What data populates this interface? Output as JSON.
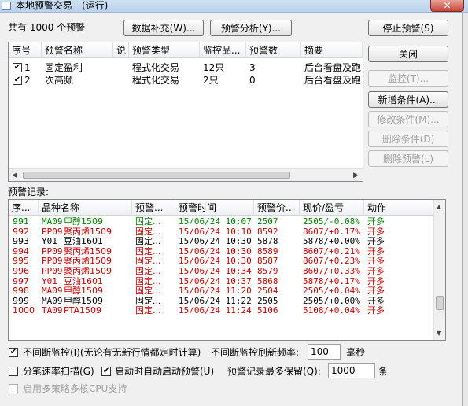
{
  "window": {
    "title": "本地预警交易 - (运行)",
    "close_glyph": "✕"
  },
  "summary": {
    "prefix": "共有",
    "count": "1000",
    "suffix": "个预警"
  },
  "toolbar": {
    "data_supplement": "数据补充(W)...",
    "alert_analysis": "预警分析(Y)..."
  },
  "side_buttons": {
    "stop_alert": "停止预警(S)",
    "close": "关闭",
    "monitor": "监控(T)...",
    "add_condition": "新增条件(A)...",
    "modify_condition": "修改条件(M)...",
    "delete_condition": "删除条件(D)",
    "delete_alert": "删除预警(L)"
  },
  "conditions": {
    "headers": [
      "序号",
      "预警名称",
      "说",
      "预警类型",
      "监控品...",
      "预警数",
      "摘要"
    ],
    "rows": [
      {
        "checked": true,
        "index": "1",
        "name": "固定盈利",
        "type": "程式化交易",
        "monitor": "12只",
        "count": "3",
        "summary": "后台看盘及跑"
      },
      {
        "checked": true,
        "index": "2",
        "name": "次高频",
        "type": "程式化交易",
        "monitor": "2只",
        "count": "0",
        "summary": "后台看盘及跑"
      }
    ]
  },
  "records": {
    "label": "预警记录:",
    "headers": [
      "序...",
      "品种名称",
      "预警...",
      "预警时间",
      "预警价...",
      "现价/盈亏",
      "动作"
    ],
    "rows": [
      {
        "no": "991",
        "code": "MA09",
        "name": "甲醇1509",
        "kind": "固定...",
        "time": "15/06/24 10:07",
        "price": "2507",
        "pnl": "2505/-0.08%",
        "action": "开多",
        "color": "green"
      },
      {
        "no": "992",
        "code": "PP09",
        "name": "聚丙烯1509",
        "kind": "固定...",
        "time": "15/06/24 10:10",
        "price": "8592",
        "pnl": "8607/+0.17%",
        "action": "开多",
        "color": "red"
      },
      {
        "no": "993",
        "code": "Y01",
        "name": "豆油1601",
        "kind": "固定...",
        "time": "15/06/24 10:30",
        "price": "5878",
        "pnl": "5878/+0.00%",
        "action": "开多",
        "color": "black"
      },
      {
        "no": "994",
        "code": "PP09",
        "name": "聚丙烯1509",
        "kind": "固定...",
        "time": "15/06/24 10:30",
        "price": "8589",
        "pnl": "8607/+0.21%",
        "action": "开多",
        "color": "red"
      },
      {
        "no": "995",
        "code": "PP09",
        "name": "聚丙烯1509",
        "kind": "固定...",
        "time": "15/06/24 10:30",
        "price": "8587",
        "pnl": "8607/+0.23%",
        "action": "开多",
        "color": "red"
      },
      {
        "no": "996",
        "code": "PP09",
        "name": "聚丙烯1509",
        "kind": "固定...",
        "time": "15/06/24 10:34",
        "price": "8579",
        "pnl": "8607/+0.33%",
        "action": "开多",
        "color": "red"
      },
      {
        "no": "997",
        "code": "Y01",
        "name": "豆油1601",
        "kind": "固定...",
        "time": "15/06/24 10:37",
        "price": "5868",
        "pnl": "5878/+0.17%",
        "action": "开多",
        "color": "red"
      },
      {
        "no": "998",
        "code": "MA09",
        "name": "甲醇1509",
        "kind": "固定...",
        "time": "15/06/24 11:20",
        "price": "2504",
        "pnl": "2505/+0.04%",
        "action": "开多",
        "color": "red"
      },
      {
        "no": "999",
        "code": "MA09",
        "name": "甲醇1509",
        "kind": "固定...",
        "time": "15/06/24 11:22",
        "price": "2505",
        "pnl": "2505/+0.00%",
        "action": "开多",
        "color": "black"
      },
      {
        "no": "1000",
        "code": "TA09",
        "name": "PTA1509",
        "kind": "固定...",
        "time": "15/06/24 11:24",
        "price": "5106",
        "pnl": "5108/+0.04%",
        "action": "开多",
        "color": "red"
      }
    ]
  },
  "options": {
    "continuous_monitor": "不间断监控(I)(无论有无新行情都定时计算)",
    "refresh_label": "不间断监控刷新频率:",
    "refresh_value": "100",
    "refresh_unit": "毫秒",
    "tick_scan": "分笔速率扫描(G)",
    "auto_start": "启动时自动启动预警(U)",
    "max_records_label": "预警记录最多保留(Q):",
    "max_records_value": "1000",
    "max_records_unit": "条",
    "multi_core": "启用多策略多核CPU支持"
  },
  "colors": {
    "green": "#008000",
    "red": "#cc0000",
    "black": "#000000"
  }
}
